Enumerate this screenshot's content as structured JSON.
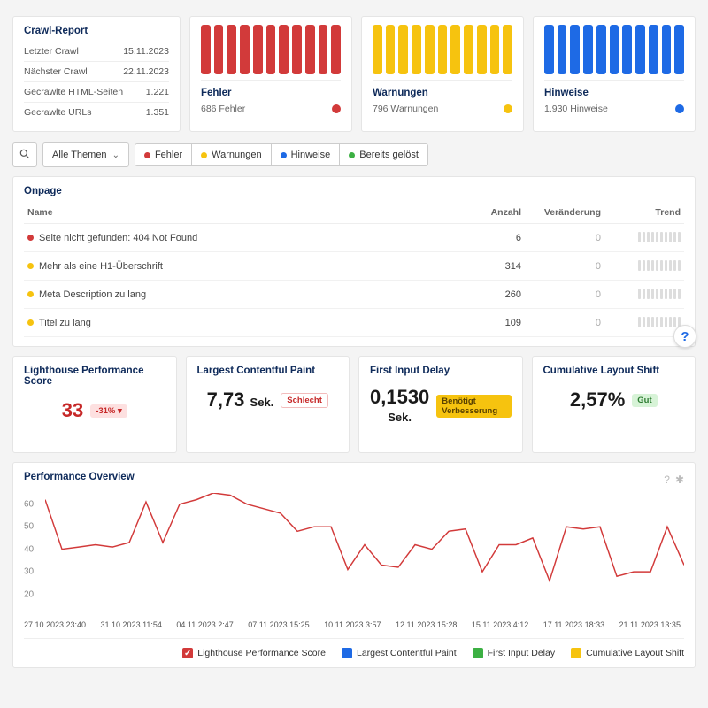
{
  "colors": {
    "red": "#d23a3a",
    "yellow": "#f6c30f",
    "blue": "#1e6ae5",
    "green": "#3cb043"
  },
  "crawl_report": {
    "title": "Crawl-Report",
    "rows": [
      {
        "label": "Letzter Crawl",
        "value": "15.11.2023"
      },
      {
        "label": "Nächster Crawl",
        "value": "22.11.2023"
      },
      {
        "label": "Gecrawlte HTML-Seiten",
        "value": "1.221"
      },
      {
        "label": "Gecrawlte URLs",
        "value": "1.351"
      }
    ]
  },
  "status_cards": [
    {
      "title": "Fehler",
      "sub": "686 Fehler",
      "color": "#d23a3a"
    },
    {
      "title": "Warnungen",
      "sub": "796 Warnungen",
      "color": "#f6c30f"
    },
    {
      "title": "Hinweise",
      "sub": "1.930 Hinweise",
      "color": "#1e6ae5"
    }
  ],
  "filter": {
    "dropdown": "Alle Themen",
    "tabs": [
      {
        "label": "Fehler",
        "color": "#d23a3a"
      },
      {
        "label": "Warnungen",
        "color": "#f6c30f"
      },
      {
        "label": "Hinweise",
        "color": "#1e6ae5"
      },
      {
        "label": "Bereits gelöst",
        "color": "#3cb043"
      }
    ]
  },
  "onpage": {
    "title": "Onpage",
    "columns": {
      "name": "Name",
      "count": "Anzahl",
      "change": "Veränderung",
      "trend": "Trend"
    },
    "rows": [
      {
        "dot": "#d23a3a",
        "name": "Seite nicht gefunden: 404 Not Found",
        "count": "6",
        "change": "0"
      },
      {
        "dot": "#f6c30f",
        "name": "Mehr als eine H1-Überschrift",
        "count": "314",
        "change": "0"
      },
      {
        "dot": "#f6c30f",
        "name": "Meta Description zu lang",
        "count": "260",
        "change": "0"
      },
      {
        "dot": "#f6c30f",
        "name": "Titel zu lang",
        "count": "109",
        "change": "0"
      }
    ]
  },
  "metrics": {
    "lps": {
      "title": "Lighthouse Performance Score",
      "value": "33",
      "badge": "-31% ▾",
      "badge_class": "badge-red-light"
    },
    "lcp": {
      "title": "Largest Contentful Paint",
      "value": "7,73",
      "unit": "Sek.",
      "badge": "Schlecht",
      "badge_class": "badge-red"
    },
    "fid": {
      "title": "First Input Delay",
      "value": "0,1530",
      "unit": "Sek.",
      "badge": "Benötigt Verbesserung",
      "badge_class": "badge-yellow"
    },
    "cls": {
      "title": "Cumulative Layout Shift",
      "value": "2,57%",
      "badge": "Gut",
      "badge_class": "badge-green"
    }
  },
  "performance_overview": {
    "title": "Performance Overview",
    "legend": [
      {
        "label": "Lighthouse Performance Score",
        "color": "#d23a3a",
        "checked": true
      },
      {
        "label": "Largest Contentful Paint",
        "color": "#1e6ae5"
      },
      {
        "label": "First Input Delay",
        "color": "#3cb043"
      },
      {
        "label": "Cumulative Layout Shift",
        "color": "#f6c30f"
      }
    ]
  },
  "help_glyph": "?",
  "chart_data": {
    "type": "line",
    "title": "Performance Overview",
    "xlabel": "",
    "ylabel": "",
    "ylim": [
      10,
      65
    ],
    "y_ticks": [
      20,
      30,
      40,
      50,
      60
    ],
    "x_ticks": [
      "27.10.2023 23:40",
      "31.10.2023 11:54",
      "04.11.2023 2:47",
      "07.11.2023 15:25",
      "10.11.2023 3:57",
      "12.11.2023 15:28",
      "15.11.2023 4:12",
      "17.11.2023 18:33",
      "21.11.2023 13:35"
    ],
    "series": [
      {
        "name": "Lighthouse Performance Score",
        "color": "#d23a3a",
        "values": [
          62,
          40,
          41,
          42,
          41,
          43,
          61,
          43,
          60,
          62,
          65,
          64,
          60,
          58,
          56,
          48,
          50,
          50,
          31,
          42,
          33,
          32,
          42,
          40,
          48,
          49,
          30,
          42,
          42,
          45,
          26,
          50,
          49,
          50,
          28,
          30,
          30,
          50,
          33
        ]
      }
    ],
    "legend_position": "bottom"
  }
}
